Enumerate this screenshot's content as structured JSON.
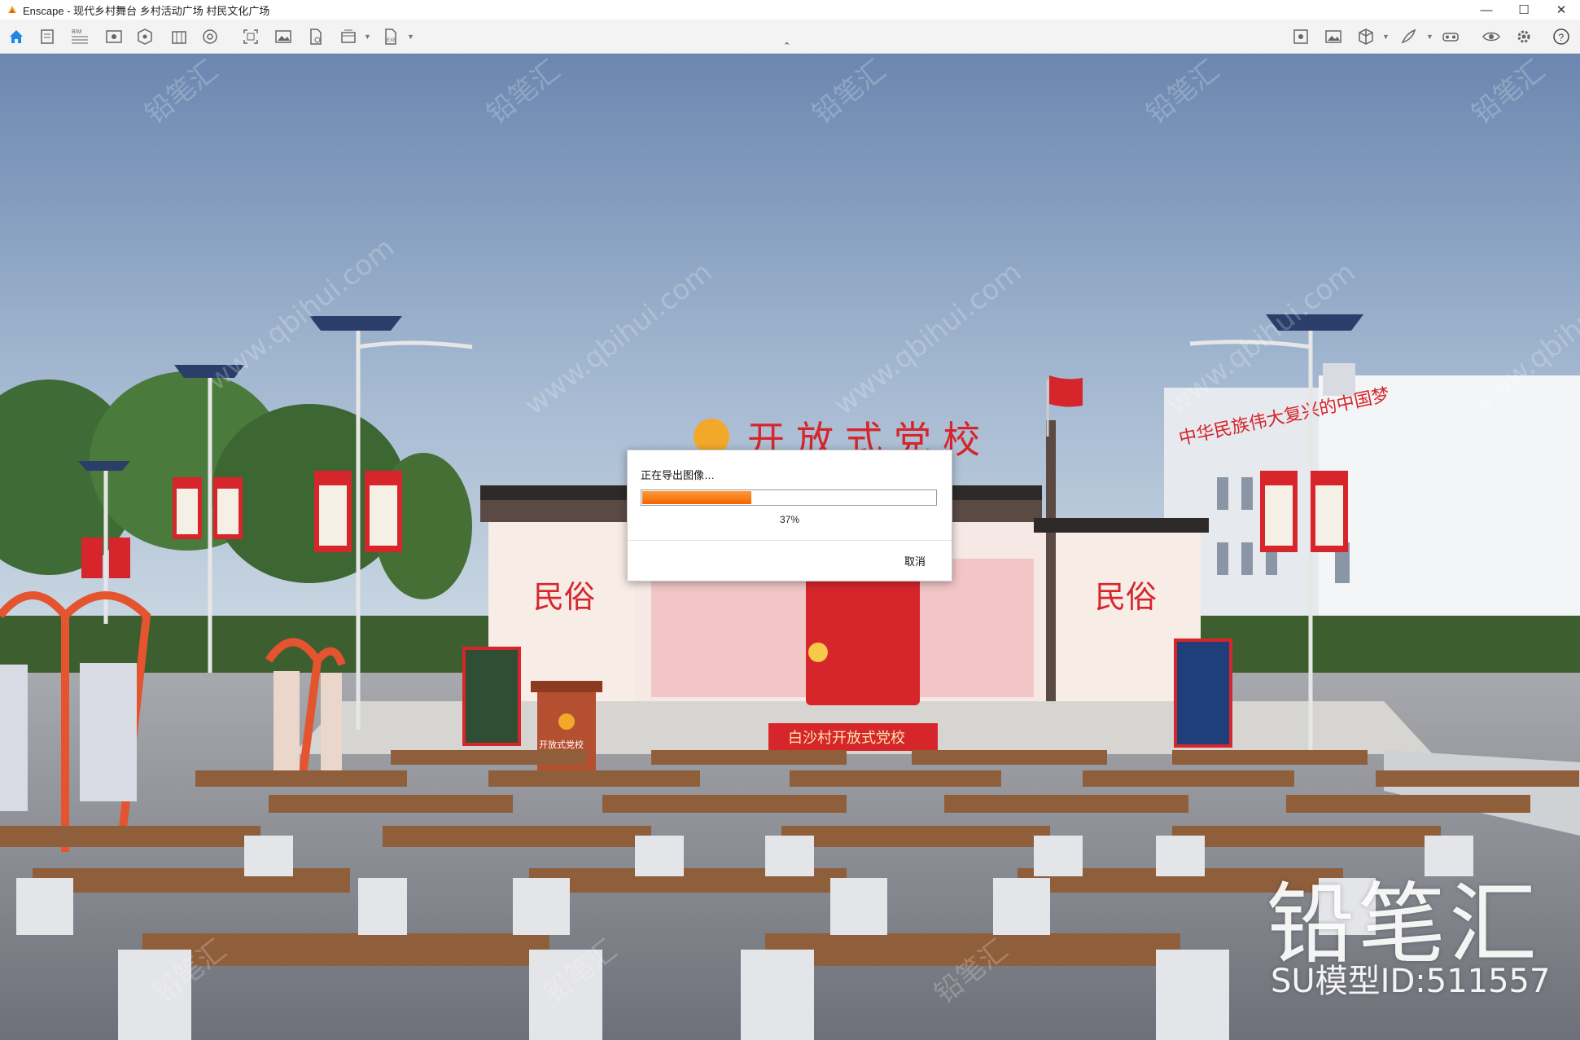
{
  "window": {
    "title": "Enscape - 现代乡村舞台 乡村活动广场 村民文化广场",
    "controls": [
      "minimize-icon",
      "maximize-icon",
      "close-icon"
    ]
  },
  "toolbar": {
    "left_icons": [
      "home-icon",
      "document-icon",
      "bim-icon",
      "view-icon",
      "asset-icon",
      "library-icon",
      "settings-wheel-icon",
      "capture-icon",
      "screenshot-icon",
      "render-file-icon",
      "batch-render-icon",
      "export-exe-icon"
    ],
    "center_caret": "⌃",
    "right_icons": [
      "sun-icon",
      "image-icon",
      "cube-icon",
      "feather-icon",
      "vr-headset-icon",
      "eye-icon",
      "gear-icon",
      "help-icon"
    ],
    "bim_label": "BIM",
    "exe_label": "EXE"
  },
  "scene": {
    "school_sign": "开放式党校",
    "podium_label": "开放式党校",
    "stage_banner": "白沙村开放式党校",
    "panel_left_title": "民俗",
    "panel_right_title": "民俗",
    "building_slogan": "中华民族伟大复兴的中国梦"
  },
  "dialog": {
    "title": "正在导出图像…",
    "progress": 0.37,
    "percent_label": "37%",
    "cancel_label": "取消"
  },
  "watermark": {
    "brand": "铅笔汇",
    "model_id": "SU模型ID:511557",
    "repeat_text": "www.qbihui.com",
    "repeat_brand": "铅笔汇"
  },
  "colors": {
    "accent": "#f26500",
    "party_red": "#d6262c",
    "sky": "#7d98bd"
  }
}
